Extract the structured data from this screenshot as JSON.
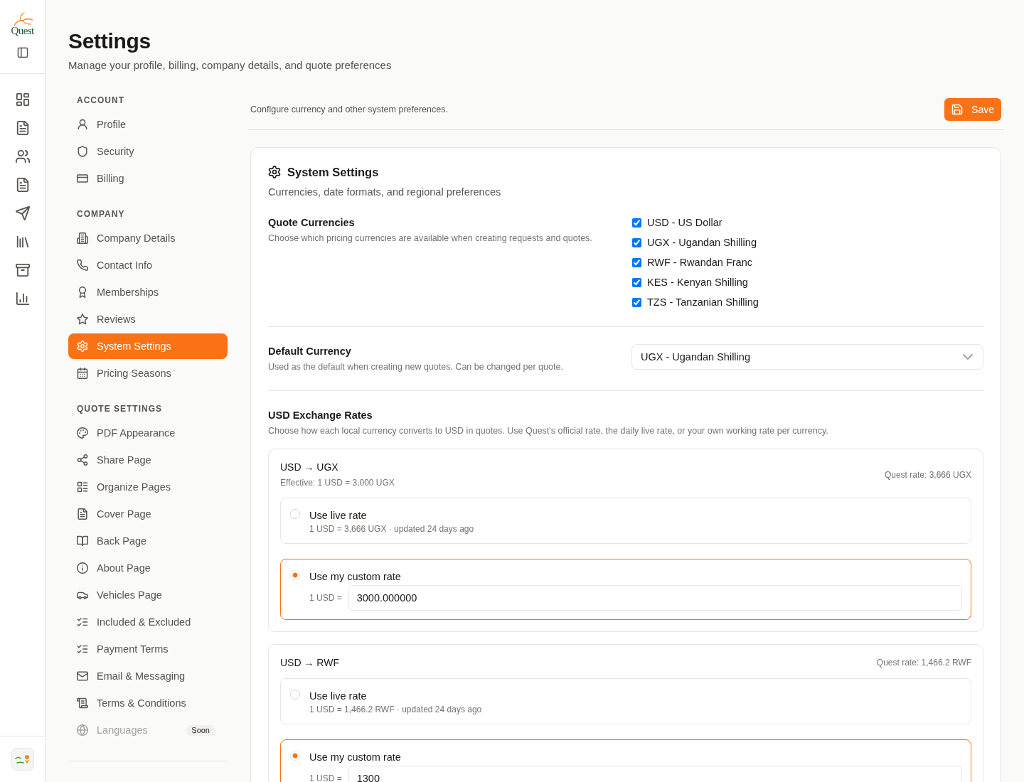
{
  "brand": {
    "name": "Quest"
  },
  "page_header": {
    "title": "Settings",
    "subtitle": "Manage your profile, billing, company details, and quote preferences"
  },
  "settings_nav": {
    "sections": [
      {
        "heading": "ACCOUNT",
        "items": [
          {
            "label": "Profile",
            "selected": false,
            "disabled": false
          },
          {
            "label": "Security",
            "selected": false,
            "disabled": false
          },
          {
            "label": "Billing",
            "selected": false,
            "disabled": false
          }
        ]
      },
      {
        "heading": "COMPANY",
        "items": [
          {
            "label": "Company Details",
            "selected": false,
            "disabled": false
          },
          {
            "label": "Contact Info",
            "selected": false,
            "disabled": false
          },
          {
            "label": "Memberships",
            "selected": false,
            "disabled": false
          },
          {
            "label": "Reviews",
            "selected": false,
            "disabled": false
          },
          {
            "label": "System Settings",
            "selected": true,
            "disabled": false
          },
          {
            "label": "Pricing Seasons",
            "selected": false,
            "disabled": false
          }
        ]
      },
      {
        "heading": "QUOTE SETTINGS",
        "items": [
          {
            "label": "PDF Appearance",
            "selected": false,
            "disabled": false
          },
          {
            "label": "Share Page",
            "selected": false,
            "disabled": false
          },
          {
            "label": "Organize Pages",
            "selected": false,
            "disabled": false
          },
          {
            "label": "Cover Page",
            "selected": false,
            "disabled": false
          },
          {
            "label": "Back Page",
            "selected": false,
            "disabled": false
          },
          {
            "label": "About Page",
            "selected": false,
            "disabled": false
          },
          {
            "label": "Vehicles Page",
            "selected": false,
            "disabled": false
          },
          {
            "label": "Included & Excluded",
            "selected": false,
            "disabled": false
          },
          {
            "label": "Payment Terms",
            "selected": false,
            "disabled": false
          },
          {
            "label": "Email & Messaging",
            "selected": false,
            "disabled": false
          },
          {
            "label": "Terms & Conditions",
            "selected": false,
            "disabled": false
          },
          {
            "label": "Languages",
            "selected": false,
            "disabled": true,
            "badge": "Soon"
          }
        ]
      }
    ]
  },
  "content_header": {
    "description": "Configure currency and other system preferences.",
    "save_button": "Save"
  },
  "system_settings": {
    "title": "System Settings",
    "subtitle": "Currencies, date formats, and regional preferences",
    "quote_currencies": {
      "label": "Quote Currencies",
      "description": "Choose which pricing currencies are available when creating requests and quotes.",
      "options": [
        {
          "label": "USD - US Dollar",
          "checked": true
        },
        {
          "label": "UGX - Ugandan Shilling",
          "checked": true
        },
        {
          "label": "RWF - Rwandan Franc",
          "checked": true
        },
        {
          "label": "KES - Kenyan Shilling",
          "checked": true
        },
        {
          "label": "TZS - Tanzanian Shilling",
          "checked": true
        }
      ]
    },
    "default_currency": {
      "label": "Default Currency",
      "description": "Used as the default when creating new quotes. Can be changed per quote.",
      "value": "UGX - Ugandan Shilling"
    },
    "exchange_rates": {
      "label": "USD Exchange Rates",
      "description": "Choose how each local currency converts to USD in quotes. Use Quest's official rate, the daily live rate, or your own working rate per currency.",
      "pairs": [
        {
          "title": "USD → UGX",
          "effective": "Effective: 1 USD = 3,000 UGX",
          "quest_rate": "Quest rate: 3,666 UGX",
          "options": [
            {
              "kind": "live",
              "label": "Use live rate",
              "detail": "1 USD = 3,666 UGX · updated 24 days ago",
              "selected": false
            },
            {
              "kind": "custom",
              "label": "Use my custom rate",
              "prefix": "1 USD =",
              "value": "3000.000000",
              "selected": true
            }
          ]
        },
        {
          "title": "USD → RWF",
          "quest_rate": "Quest rate: 1,466.2 RWF",
          "options": [
            {
              "kind": "live",
              "label": "Use live rate",
              "detail": "1 USD = 1,466.2 RWF · updated 24 days ago",
              "selected": false
            },
            {
              "kind": "custom",
              "label": "Use my custom rate",
              "prefix": "1 USD =",
              "value": "1300",
              "selected": true
            }
          ]
        }
      ]
    }
  }
}
